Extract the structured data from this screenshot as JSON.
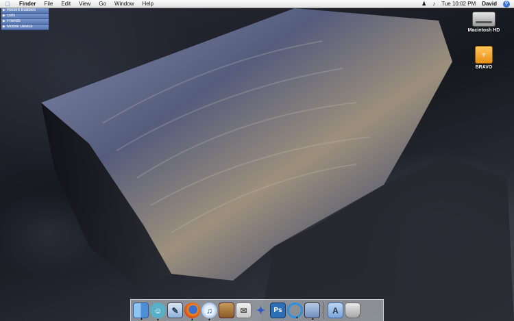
{
  "menubar": {
    "apple_icon": "apple-logo",
    "app_name": "Finder",
    "menus": [
      "File",
      "Edit",
      "View",
      "Go",
      "Window",
      "Help"
    ],
    "status_icons": [
      "fast-user-icon",
      "volume-icon"
    ],
    "clock": "Tue 10:02 PM",
    "user": "David",
    "spotlight_icon": "spotlight-icon"
  },
  "sidebar": {
    "items": [
      {
        "label": "Recent Buddies"
      },
      {
        "label": "Girls"
      },
      {
        "label": "Friends"
      },
      {
        "label": "Mobile Device"
      }
    ]
  },
  "desktop_icons": {
    "macintosh_hd": "Macintosh HD",
    "bravo": "BRAVO"
  },
  "dock": {
    "apps": [
      {
        "name": "finder-icon",
        "glyph": "",
        "running": true
      },
      {
        "name": "adium-icon",
        "glyph": "☺",
        "running": true
      },
      {
        "name": "preview-icon",
        "glyph": "✎",
        "running": false
      },
      {
        "name": "firefox-icon",
        "glyph": "",
        "running": true
      },
      {
        "name": "itunes-icon",
        "glyph": "♫",
        "running": true
      },
      {
        "name": "iphoto-icon",
        "glyph": "",
        "running": false
      },
      {
        "name": "mail-icon",
        "glyph": "✉",
        "running": false
      },
      {
        "name": "bird-icon",
        "glyph": "🐦",
        "running": false
      },
      {
        "name": "photoshop-icon",
        "glyph": "Ps",
        "running": false
      },
      {
        "name": "sync-icon",
        "glyph": "",
        "running": true
      },
      {
        "name": "system-preferences-icon",
        "glyph": "",
        "running": true
      }
    ],
    "right": [
      {
        "name": "applications-folder-icon",
        "glyph": "A"
      },
      {
        "name": "trash-icon",
        "glyph": ""
      }
    ]
  }
}
